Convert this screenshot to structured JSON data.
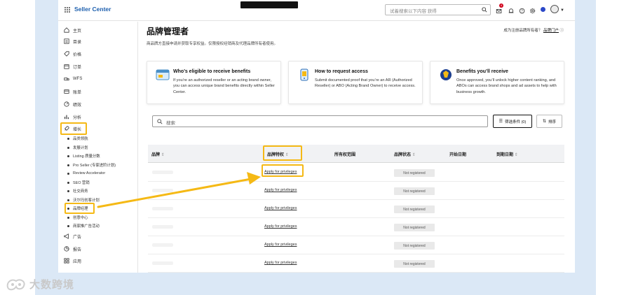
{
  "topbar": {
    "app_title": "Seller Center",
    "black_tab": "",
    "search_placeholder": "试着搜索以下内容 获得",
    "notification_count": "4"
  },
  "sidebar": {
    "items": [
      {
        "label": "主页"
      },
      {
        "label": "目录"
      },
      {
        "label": "价格"
      },
      {
        "label": "订单"
      },
      {
        "label": "WFS"
      },
      {
        "label": "账单"
      },
      {
        "label": "绩效"
      },
      {
        "label": "分析"
      },
      {
        "label": "增长"
      },
      {
        "label": "广告"
      },
      {
        "label": "报告"
      },
      {
        "label": "应用"
      }
    ],
    "growth_subitems": [
      {
        "label": "品类领航"
      },
      {
        "label": "发展计划"
      },
      {
        "label": "Listing 质量分数"
      },
      {
        "label": "Pro Seller (专家进阶计划)"
      },
      {
        "label": "Review Accelerator"
      },
      {
        "label": "SEO 营销"
      },
      {
        "label": "社交商务"
      },
      {
        "label": "沃尔玛创客计划"
      },
      {
        "label": "品牌经理"
      },
      {
        "label": "创意中心"
      },
      {
        "label": "商家推广告活动"
      }
    ]
  },
  "main": {
    "title": "品牌管理者",
    "subtitle": "商品牌方直接申请并获取专享权益。仅限授权经销商及代理品牌所有者使用。",
    "top_right_prefix": "成为注册品牌所有者？",
    "top_right_link": "品牌门户",
    "cards": [
      {
        "title": "Who’s eligible to receive benefits",
        "body": "If you’re an authorized reseller or an acting brand owner, you can access unique brand benefits directly within Seller Center."
      },
      {
        "title": "How to request access",
        "body": "Submit documented proof that you’re an AR (Authorized Reseller) or ABO (Acting Brand Owner) to receive access."
      },
      {
        "title": "Benefits you’ll receive",
        "body": "Once approved, you’ll unlock higher content ranking, and ABOs can access brand shops and ad assets to help with business growth."
      }
    ],
    "search_placeholder": "搜索",
    "filter_button": "筛选条件 (0)",
    "sort_button": "排序",
    "table": {
      "headers": [
        "品牌",
        "品牌特权",
        "所有权范围",
        "品牌状态",
        "开始日期",
        "到期日期"
      ],
      "rows": [
        {
          "privilege": "Apply for privileges",
          "status": "Not registered"
        },
        {
          "privilege": "Apply for privileges",
          "status": "Not registered"
        },
        {
          "privilege": "Apply for privileges",
          "status": "Not registered"
        },
        {
          "privilege": "Apply for privileges",
          "status": "Not registered"
        },
        {
          "privilege": "Apply for privileges",
          "status": "Not registered"
        },
        {
          "privilege": "Apply for privileges",
          "status": "Not registered"
        }
      ]
    }
  },
  "watermark": {
    "text": "大数跨境"
  },
  "colors": {
    "highlight": "#f5b915",
    "brand_blue": "#1d5fae",
    "frame_bg": "#dbe8f6",
    "table_header_bg": "#f1f2f4"
  }
}
